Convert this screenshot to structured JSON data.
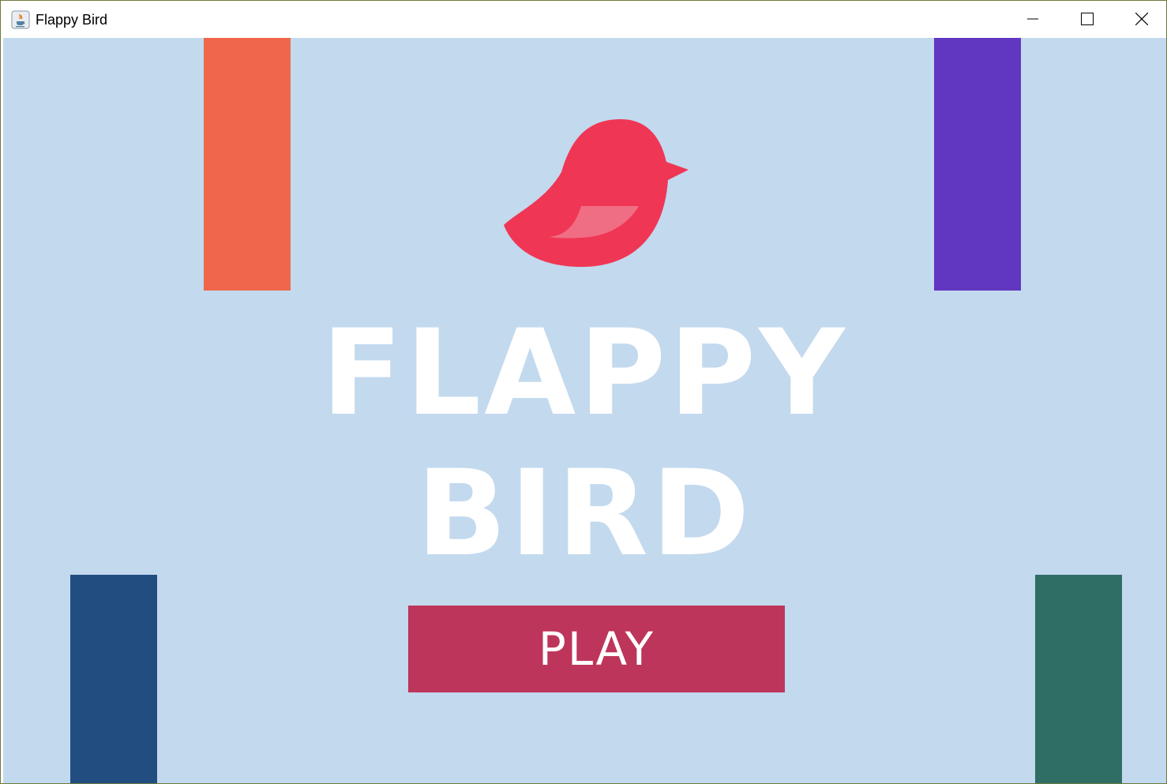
{
  "window": {
    "title": "Flappy Bird",
    "icon": "java-cup-icon",
    "controls": [
      "minimize-icon",
      "maximize-icon",
      "close-icon"
    ]
  },
  "game": {
    "background_color": "#c3d9ee",
    "title_line_1": "FLAPPY",
    "title_line_2": "BIRD",
    "play_label": "PLAY",
    "play_button_color": "#bd355a",
    "bird_color": "#ef3755",
    "bird_wing_color": "#f06e84",
    "pipes": [
      {
        "name": "top-left-pipe",
        "color": "#f0664c"
      },
      {
        "name": "top-right-pipe",
        "color": "#6136c0"
      },
      {
        "name": "bottom-left-pipe",
        "color": "#214d81"
      },
      {
        "name": "bottom-right-pipe",
        "color": "#2f6e65"
      }
    ]
  }
}
